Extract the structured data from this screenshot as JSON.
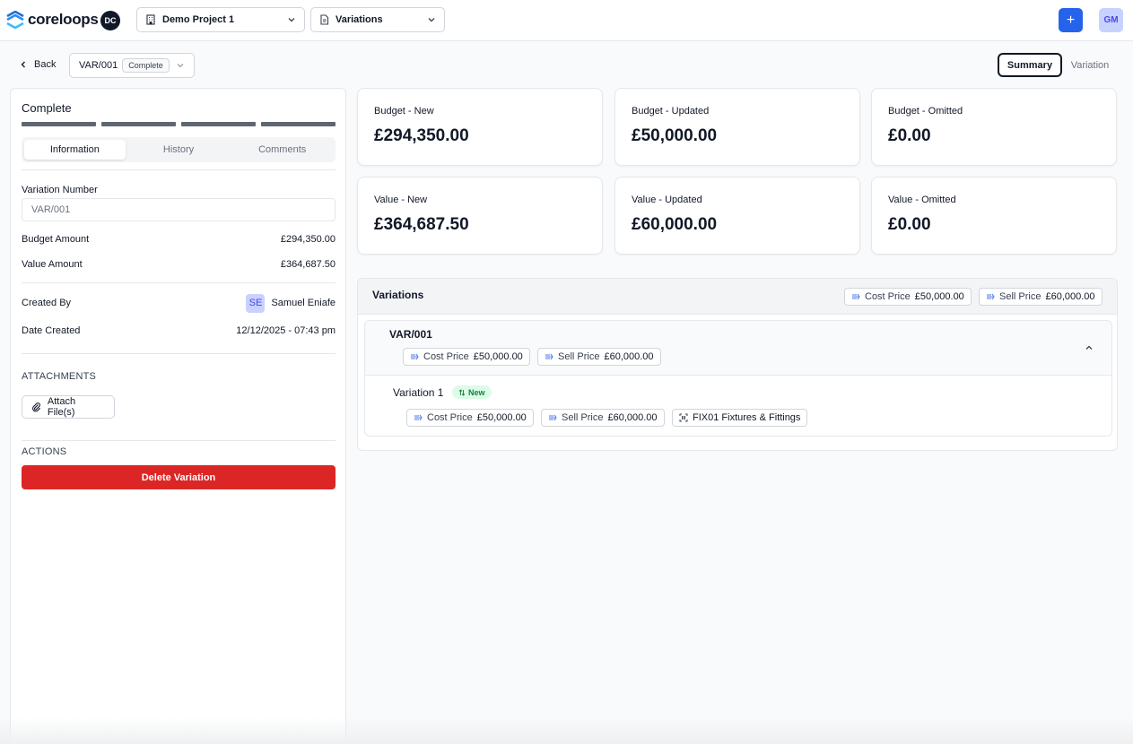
{
  "app": {
    "brand": "coreloops",
    "user_initials": "DC",
    "account_initials": "GM",
    "add_icon": "+"
  },
  "project_select": {
    "value": "Demo Project 1"
  },
  "module_select": {
    "value": "Variations"
  },
  "toolbar": {
    "back_label": "Back",
    "variation_id": "VAR/001",
    "status": "Complete",
    "view_summary": "Summary",
    "view_variation": "Variation"
  },
  "panel": {
    "title": "Complete",
    "tabs": [
      {
        "label": "Information",
        "active": true
      },
      {
        "label": "History",
        "active": false
      },
      {
        "label": "Comments",
        "active": false
      }
    ],
    "variation_number_label": "Variation Number",
    "variation_number_value": "VAR/001",
    "budget_amount_label": "Budget Amount",
    "budget_amount_value": "£294,350.00",
    "value_amount_label": "Value Amount",
    "value_amount_value": "£364,687.50",
    "created_by_label": "Created By",
    "created_by_initials": "SE",
    "created_by_name": "Samuel Eniafe",
    "date_created_label": "Date Created",
    "date_created_value": "12/12/2025 - 07:43 pm",
    "attachments_label": "ATTACHMENTS",
    "attach_button": "Attach File(s)",
    "actions_label": "ACTIONS",
    "delete_button": "Delete Variation"
  },
  "summary_cards": [
    {
      "label": "Budget - New",
      "value": "£294,350.00"
    },
    {
      "label": "Budget - Updated",
      "value": "£50,000.00"
    },
    {
      "label": "Budget - Omitted",
      "value": "£0.00"
    },
    {
      "label": "Value - New",
      "value": "£364,687.50"
    },
    {
      "label": "Value - Updated",
      "value": "£60,000.00"
    },
    {
      "label": "Value - Omitted",
      "value": "£0.00"
    }
  ],
  "variations_section": {
    "title": "Variations",
    "cost_label": "Cost Price",
    "cost_value": "£50,000.00",
    "sell_label": "Sell Price",
    "sell_value": "£60,000.00",
    "group": {
      "id": "VAR/001",
      "cost_label": "Cost Price",
      "cost_value": "£50,000.00",
      "sell_label": "Sell Price",
      "sell_value": "£60,000.00",
      "item": {
        "title": "Variation 1",
        "badge": "New",
        "cost_label": "Cost Price",
        "cost_value": "£50,000.00",
        "sell_label": "Sell Price",
        "sell_value": "£60,000.00",
        "code": "FIX01 Fixtures & Fittings"
      }
    }
  },
  "colors": {
    "accent": "#2563eb",
    "danger": "#dc2626",
    "success_bg": "#dcfce7",
    "success_text": "#15803d"
  }
}
